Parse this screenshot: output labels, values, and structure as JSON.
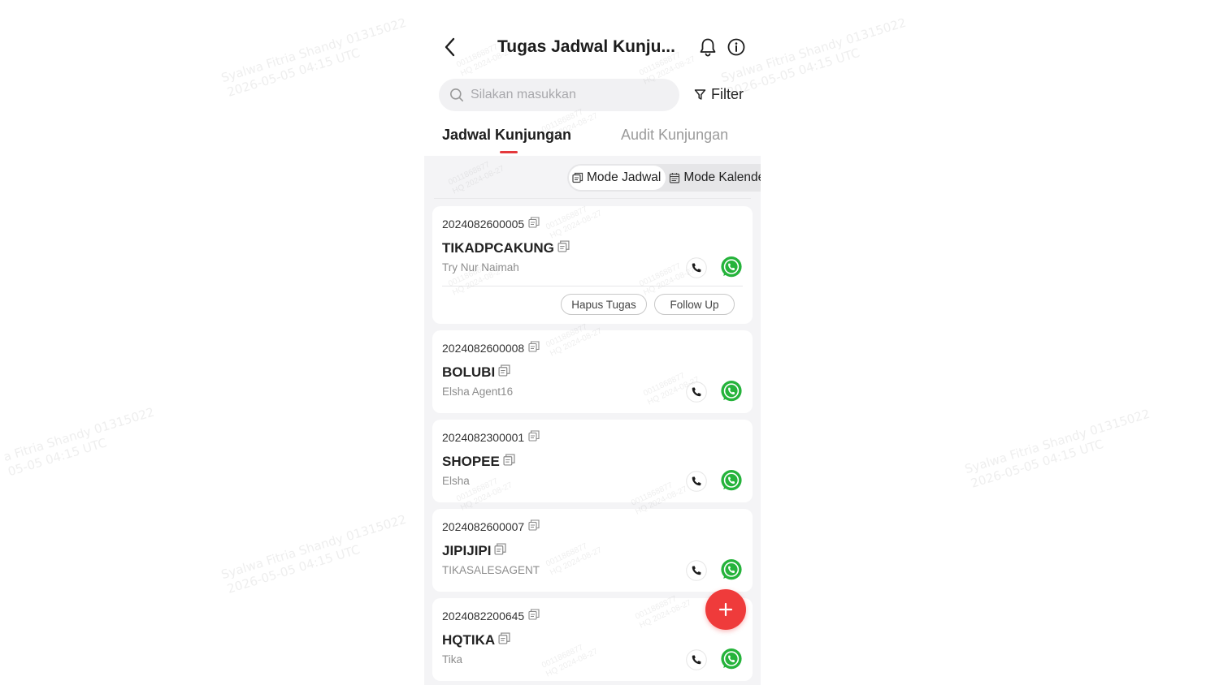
{
  "header": {
    "title": "Tugas Jadwal Kunju..."
  },
  "search": {
    "placeholder": "Silakan masukkan",
    "value": ""
  },
  "filter": {
    "label": "Filter"
  },
  "tabs": [
    {
      "label": "Jadwal Kunjungan",
      "active": true
    },
    {
      "label": "Audit Kunjungan",
      "active": false
    }
  ],
  "mode_switch": [
    {
      "label": "Mode Jadwal",
      "active": true
    },
    {
      "label": "Mode Kalender",
      "active": false
    }
  ],
  "tasks": [
    {
      "id": "2024082600005",
      "name": "TIKADPCAKUNG",
      "agent": "Try Nur Naimah",
      "actions": [
        "Hapus Tugas",
        "Follow Up"
      ]
    },
    {
      "id": "2024082600008",
      "name": "BOLUBI",
      "agent": "Elsha Agent16"
    },
    {
      "id": "2024082300001",
      "name": "SHOPEE",
      "agent": "Elsha"
    },
    {
      "id": "2024082600007",
      "name": "JIPIJIPI",
      "agent": "TIKASALESAGENT"
    },
    {
      "id": "2024082200645",
      "name": "HQTIKA",
      "agent": "Tika"
    }
  ],
  "watermark": {
    "line1": "Syalwa Fitria Shandy 01315022",
    "line2": "2026-05-05 04:15 UTC",
    "line1_cut": "a Fitria Shandy 01315022",
    "line2_cut": "05-05 04:15 UTC",
    "small1": "0011868877",
    "small2": "HQ 2024-08-27"
  },
  "colors": {
    "accent": "#e4393c",
    "fab": "#ef3b3b",
    "whatsapp": "#25b33b",
    "background": "#f4f4f6"
  },
  "icons": {
    "back": "chevron-left-icon",
    "bell": "bell-icon",
    "info": "info-icon",
    "search": "search-icon",
    "filter": "funnel-icon",
    "copy": "copy-icon",
    "phone": "phone-icon",
    "whatsapp": "whatsapp-icon",
    "add": "plus-icon"
  }
}
